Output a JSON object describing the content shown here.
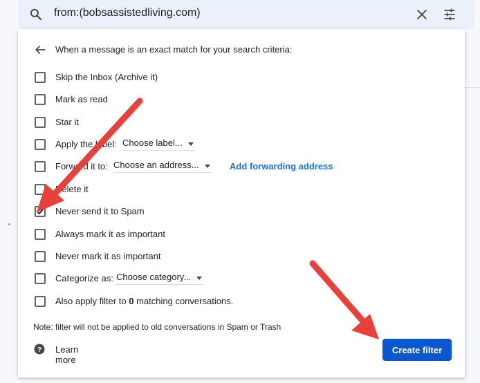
{
  "search": {
    "query": "from:(bobsassistedliving.com)"
  },
  "filter": {
    "header": "When a message is an exact match for your search criteria:",
    "options": [
      {
        "label": "Skip the Inbox (Archive it)",
        "checked": false
      },
      {
        "label": "Mark as read",
        "checked": false
      },
      {
        "label": "Star it",
        "checked": false
      },
      {
        "label": "Apply the label:",
        "checked": false,
        "dropdown": "Choose label..."
      },
      {
        "label": "Forward it to:",
        "checked": false,
        "dropdown": "Choose an address...",
        "link": "Add forwarding address"
      },
      {
        "label": "Delete it",
        "checked": false
      },
      {
        "label": "Never send it to Spam",
        "checked": true
      },
      {
        "label": "Always mark it as important",
        "checked": false
      },
      {
        "label": "Never mark it as important",
        "checked": false
      },
      {
        "label": "Categorize as:",
        "checked": false,
        "dropdown": "Choose category..."
      },
      {
        "label_prefix": "Also apply filter to",
        "count": "0",
        "label_suffix": "matching conversations.",
        "checked": false
      }
    ],
    "note": "Note: filter will not be applied to old conversations in Spam or Trash",
    "learn_more": "Learn more",
    "create_button": "Create filter"
  },
  "colors": {
    "accent": "#0b57d0",
    "link": "#1a73e8",
    "annotation_arrow": "#e8403a"
  },
  "icons": {
    "search": "search-icon",
    "clear": "close-icon",
    "tune": "tune-icon",
    "back": "arrow-back-icon",
    "help": "help-icon"
  }
}
